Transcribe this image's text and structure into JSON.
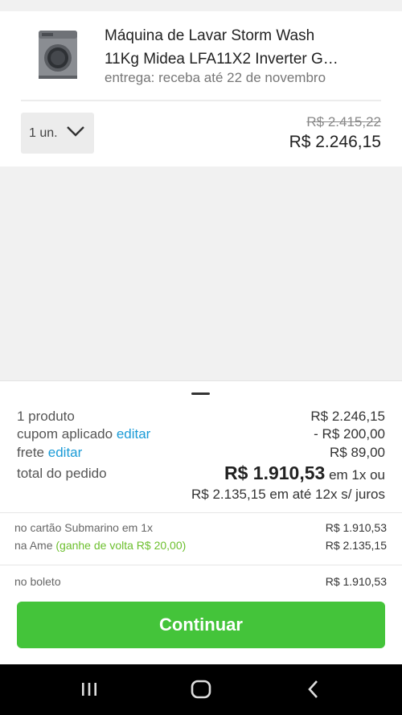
{
  "product": {
    "title_line1": "Máquina de Lavar Storm Wash",
    "title_line2": "11Kg Midea LFA11X2 Inverter G…",
    "delivery": "entrega: receba até 22 de novembro",
    "quantity": "1 un.",
    "old_price": "R$ 2.415,22",
    "price": "R$ 2.246,15"
  },
  "summary": {
    "products_label": "1 produto",
    "products_value": "R$ 2.246,15",
    "coupon_label": "cupom aplicado",
    "coupon_edit": "editar",
    "coupon_value": "- R$ 200,00",
    "shipping_label": "frete",
    "shipping_edit": "editar",
    "shipping_value": "R$ 89,00",
    "total_label": "total do pedido",
    "total_value": "R$ 1.910,53",
    "total_suffix": "em 1x ou",
    "installments": "R$ 2.135,15 em até 12x s/ juros"
  },
  "payment_options": [
    {
      "label": "no cartão Submarino em 1x",
      "value": "R$ 1.910,53"
    },
    {
      "label": "na Ame",
      "highlight": "(ganhe de volta R$ 20,00)",
      "value": "R$ 2.135,15"
    },
    {
      "label": "no boleto",
      "value": "R$ 1.910,53"
    }
  ],
  "cta": {
    "label": "Continuar"
  },
  "navbar": {
    "icons": [
      "recent-apps-icon",
      "home-icon",
      "back-icon"
    ]
  },
  "colors": {
    "accent_link": "#1a9bd7",
    "discount_green": "#6cbf2d",
    "cta_green": "#44c43a"
  }
}
